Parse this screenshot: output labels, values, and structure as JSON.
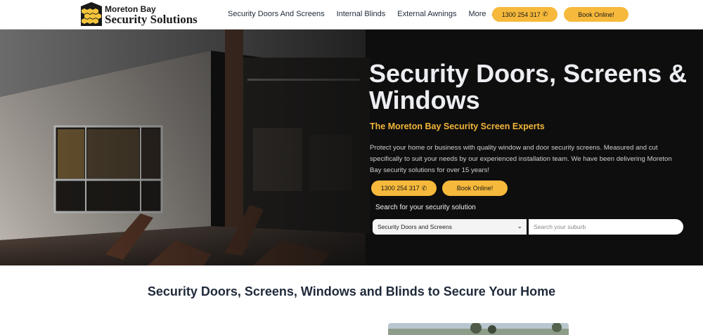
{
  "brand": {
    "line1": "Moreton Bay",
    "line2": "Security Solutions"
  },
  "nav": {
    "items": [
      "Security Doors And Screens",
      "Internal Blinds",
      "External Awnings"
    ],
    "more_label": "More"
  },
  "header_buttons": {
    "phone": "1300 254 317",
    "book": "Book Online!"
  },
  "hero": {
    "title": "Security Doors, Screens & Windows",
    "subtitle": "The Moreton Bay Security Screen Experts",
    "description": "Protect your home or business with quality window and door security screens. Measured and cut specifically to suit your needs by our experienced installation team. We have been delivering Moreton Bay security solutions for over 15 years!",
    "phone_button": "1300 254 317",
    "book_button": "Book Online!",
    "search_label": "Search for your security solution",
    "select_value": "Security Doors and Screens",
    "suburb_placeholder": "Search your suburb"
  },
  "section": {
    "heading": "Security Doors, Screens, Windows and Blinds to Secure Your Home"
  },
  "colors": {
    "accent": "#f6b93b",
    "subtitle": "#f2b53a",
    "heading": "#1f2a3a",
    "hero_bg": "#0e0e0e"
  },
  "icons": {
    "phone": "phone-icon",
    "chevron": "chevron-down-icon"
  }
}
